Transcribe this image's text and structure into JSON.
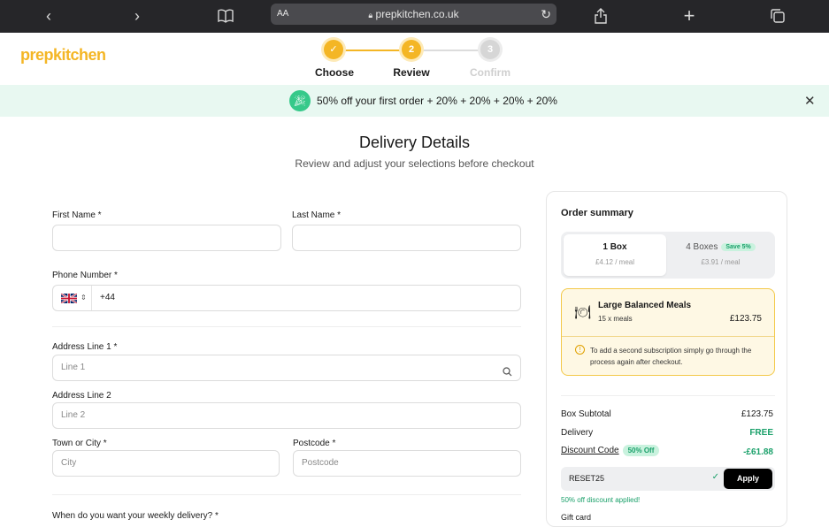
{
  "browser": {
    "aa_label": "AA",
    "url": "prepkitchen.co.uk",
    "icons": [
      "back-icon",
      "forward-icon",
      "book-icon",
      "lock-icon",
      "reload-icon",
      "share-icon",
      "plus-icon",
      "tabs-icon"
    ]
  },
  "brand": {
    "logo": "prepkitchen",
    "accent": "#f4b625"
  },
  "steps": [
    {
      "label": "Choose",
      "state": "done"
    },
    {
      "label": "Review",
      "number": "2",
      "state": "current"
    },
    {
      "label": "Confirm",
      "number": "3",
      "state": "upcoming"
    }
  ],
  "banner": {
    "text": "50% off your first order + 20% + 20% + 20% + 20%"
  },
  "page": {
    "title": "Delivery Details",
    "subtitle": "Review and adjust your selections before checkout"
  },
  "form": {
    "first_name_label": "First Name *",
    "last_name_label": "Last Name *",
    "phone_label": "Phone Number *",
    "phone_prefix": "+44",
    "address1_label": "Address Line 1 *",
    "address1_placeholder": "Line 1",
    "address2_label": "Address Line 2",
    "address2_placeholder": "Line 2",
    "city_label": "Town or City *",
    "city_placeholder": "City",
    "postcode_label": "Postcode *",
    "postcode_placeholder": "Postcode",
    "delivery_question": "When do you want your weekly delivery? *"
  },
  "summary": {
    "title": "Order summary",
    "options": [
      {
        "title": "1 Box",
        "price": "£4.12 / meal",
        "selected": true
      },
      {
        "title": "4 Boxes",
        "badge": "Save 5%",
        "price": "£3.91 / meal",
        "selected": false
      }
    ],
    "meal": {
      "name": "Large Balanced Meals",
      "qty": "15 x meals",
      "price": "£123.75",
      "note": "To add a second subscription simply go through the process again after checkout."
    },
    "box_subtotal_label": "Box Subtotal",
    "box_subtotal": "£123.75",
    "delivery_label": "Delivery",
    "delivery_value": "FREE",
    "discount_label": "Discount Code",
    "discount_badge": "50% Off",
    "discount_value": "-£61.88",
    "code": "RESET25",
    "apply_label": "Apply",
    "applied_msg": "50% off discount applied!",
    "gift_card_label": "Gift card"
  },
  "colors": {
    "green": "#1aa06a",
    "banner_bg": "#e8f8f1"
  }
}
